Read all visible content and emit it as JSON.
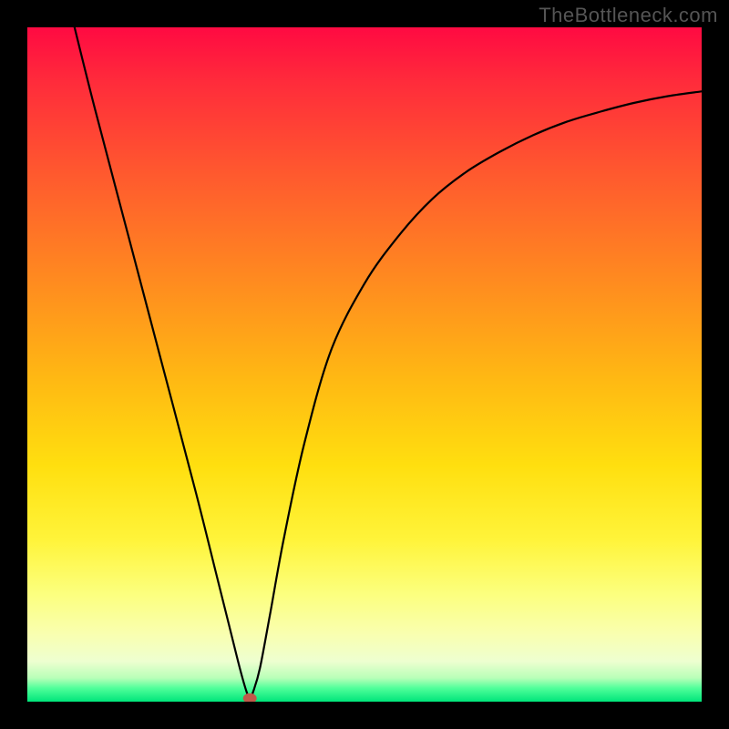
{
  "watermark": "TheBottleneck.com",
  "chart_data": {
    "type": "line",
    "title": "",
    "xlabel": "",
    "ylabel": "",
    "xlim": [
      0,
      100
    ],
    "ylim": [
      0,
      100
    ],
    "series": [
      {
        "name": "curve",
        "x": [
          7,
          10,
          15,
          20,
          25,
          28,
          30,
          31.5,
          32.5,
          33,
          33.5,
          34.5,
          36,
          38,
          41,
          45,
          50,
          55,
          60,
          65,
          70,
          75,
          80,
          85,
          90,
          95,
          100
        ],
        "y": [
          100,
          88,
          69,
          50,
          31,
          19,
          11,
          5,
          1.5,
          0.5,
          1.5,
          5,
          13,
          24,
          38,
          52,
          62,
          69,
          74.5,
          78.5,
          81.5,
          84,
          86,
          87.5,
          88.8,
          89.8,
          90.5
        ]
      }
    ],
    "marker": {
      "x": 33,
      "y": 0.5,
      "color": "#c05a4a"
    },
    "gradient_stops": [
      {
        "pos": 0,
        "color": "#ff0a42"
      },
      {
        "pos": 0.5,
        "color": "#ffb813"
      },
      {
        "pos": 0.78,
        "color": "#fff43a"
      },
      {
        "pos": 0.96,
        "color": "#b8ffb8"
      },
      {
        "pos": 1.0,
        "color": "#00e57a"
      }
    ]
  }
}
